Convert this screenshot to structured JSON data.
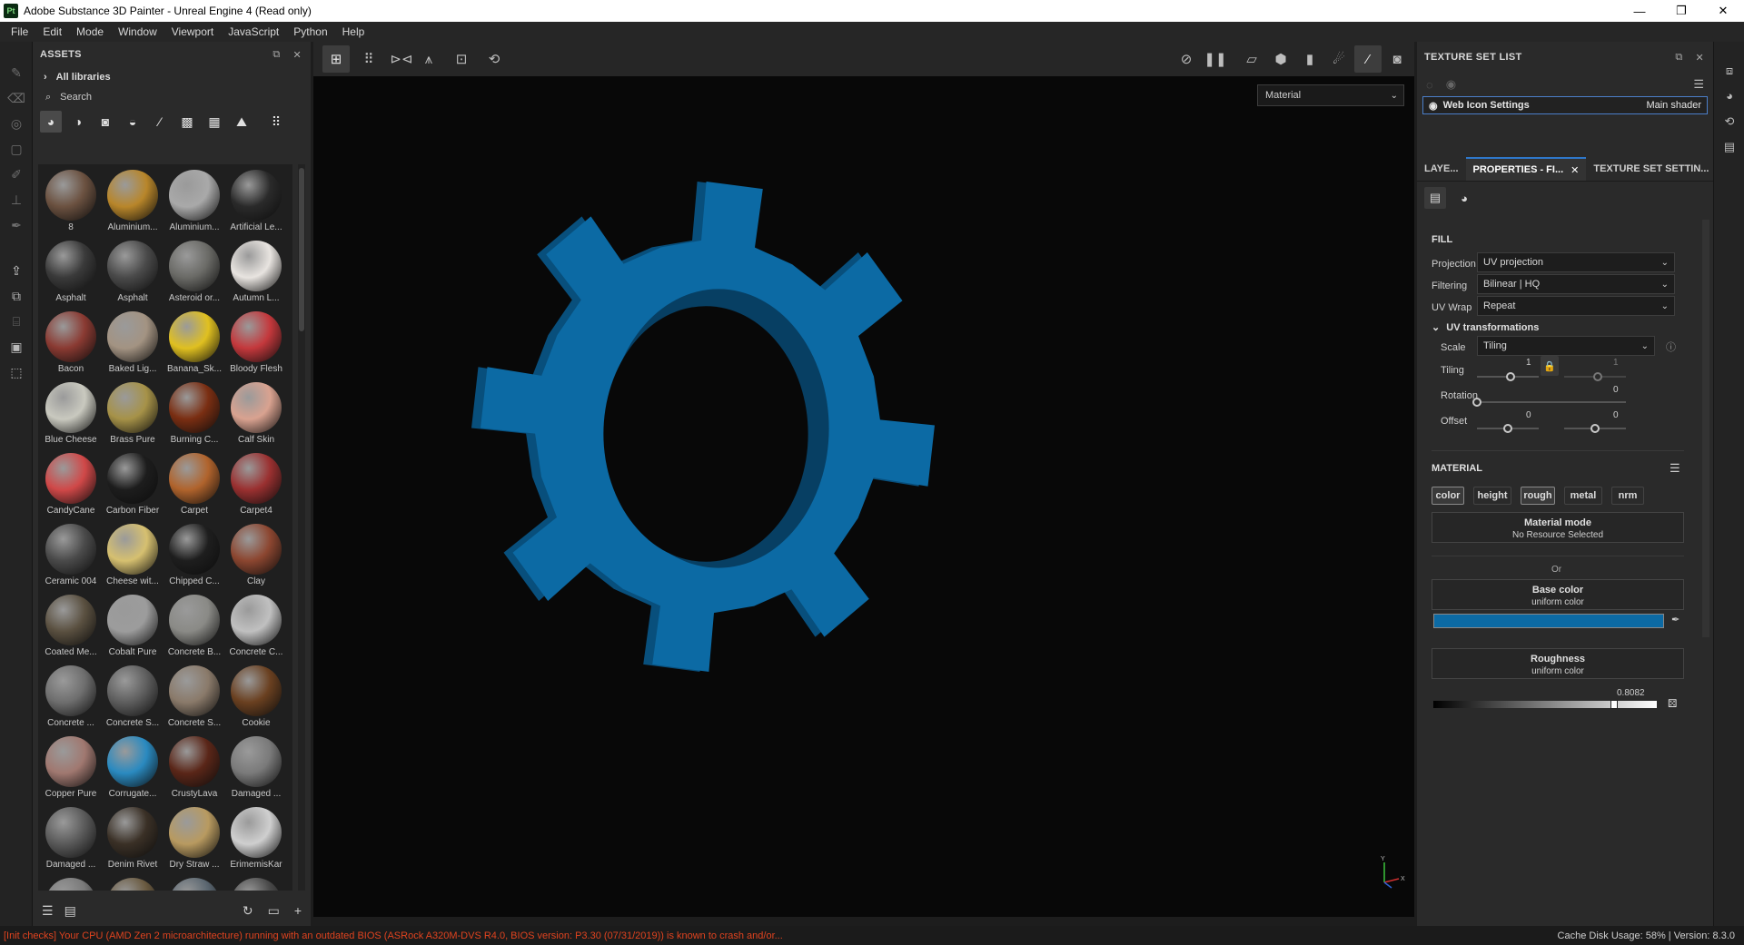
{
  "window": {
    "title": "Adobe Substance 3D Painter - Unreal Engine 4 (Read only)",
    "logo": "Pt"
  },
  "menu": [
    "File",
    "Edit",
    "Mode",
    "Window",
    "Viewport",
    "JavaScript",
    "Python",
    "Help"
  ],
  "assets": {
    "title": "ASSETS",
    "library": "All libraries",
    "search_placeholder": "Search",
    "items": [
      {
        "label": "8",
        "color": "#6b5140"
      },
      {
        "label": "Aluminium...",
        "color": "#b8862a"
      },
      {
        "label": "Aluminium...",
        "color": "#a9a9a9"
      },
      {
        "label": "Artificial Le...",
        "color": "#2a2a2a"
      },
      {
        "label": "Asphalt",
        "color": "#3a3a3a"
      },
      {
        "label": "Asphalt",
        "color": "#4a4a4a"
      },
      {
        "label": "Asteroid or...",
        "color": "#6a6a66"
      },
      {
        "label": "Autumn L...",
        "color": "#e8e4e0"
      },
      {
        "label": "Bacon",
        "color": "#8a3a32"
      },
      {
        "label": "Baked Lig...",
        "color": "#a39382"
      },
      {
        "label": "Banana_Sk...",
        "color": "#e0c020"
      },
      {
        "label": "Bloody Flesh",
        "color": "#c4383c"
      },
      {
        "label": "Blue Cheese",
        "color": "#c9c9bf"
      },
      {
        "label": "Brass Pure",
        "color": "#a69248"
      },
      {
        "label": "Burning C...",
        "color": "#7a2e12"
      },
      {
        "label": "Calf Skin",
        "color": "#d9a290"
      },
      {
        "label": "CandyCane",
        "color": "#d04848"
      },
      {
        "label": "Carbon Fiber",
        "color": "#1d1d1d"
      },
      {
        "label": "Carpet",
        "color": "#b0632c"
      },
      {
        "label": "Carpet4",
        "color": "#9a3030"
      },
      {
        "label": "Ceramic 004",
        "color": "#4a4a4a"
      },
      {
        "label": "Cheese wit...",
        "color": "#d6c070"
      },
      {
        "label": "Chipped C...",
        "color": "#1e1e1e"
      },
      {
        "label": "Clay",
        "color": "#8c4630"
      },
      {
        "label": "Coated Me...",
        "color": "#5a5040"
      },
      {
        "label": "Cobalt Pure",
        "color": "#9c9c9c"
      },
      {
        "label": "Concrete B...",
        "color": "#8a8a86"
      },
      {
        "label": "Concrete C...",
        "color": "#c0c0c0"
      },
      {
        "label": "Concrete ...",
        "color": "#6e6e6e"
      },
      {
        "label": "Concrete S...",
        "color": "#5e5e5e"
      },
      {
        "label": "Concrete S...",
        "color": "#8a7a6a"
      },
      {
        "label": "Cookie",
        "color": "#6a4020"
      },
      {
        "label": "Copper Pure",
        "color": "#a07870"
      },
      {
        "label": "Corrugate...",
        "color": "#2a8ac0"
      },
      {
        "label": "CrustyLava",
        "color": "#5a2618"
      },
      {
        "label": "Damaged ...",
        "color": "#7a7a7a"
      },
      {
        "label": "Damaged ...",
        "color": "#5a5a5a"
      },
      {
        "label": "Denim Rivet",
        "color": "#3a3026"
      },
      {
        "label": "Dry Straw ...",
        "color": "#b89a60"
      },
      {
        "label": "ErimemisKar",
        "color": "#cfcfcf"
      },
      {
        "label": "",
        "color": "#7a7a7a"
      },
      {
        "label": "",
        "color": "#6a5a40"
      },
      {
        "label": "",
        "color": "#5a6670"
      },
      {
        "label": "",
        "color": "#4a4a4a"
      }
    ]
  },
  "viewport": {
    "material_mode": "Material",
    "object_color": "#0c6aa4",
    "axis_y": "Y",
    "axis_x": "X"
  },
  "texture_set_list": {
    "title": "TEXTURE SET LIST",
    "item_name": "Web Icon Settings",
    "item_shader": "Main shader"
  },
  "tabs": [
    {
      "label": "LAYE...",
      "active": false
    },
    {
      "label": "PROPERTIES - FI...",
      "active": true
    },
    {
      "label": "TEXTURE SET SETTIN...",
      "active": false
    }
  ],
  "properties": {
    "fill_header": "FILL",
    "projection": {
      "label": "Projection",
      "value": "UV projection"
    },
    "filtering": {
      "label": "Filtering",
      "value": "Bilinear | HQ"
    },
    "uv_wrap": {
      "label": "UV Wrap",
      "value": "Repeat"
    },
    "uv_transform_header": "UV transformations",
    "scale": {
      "label": "Scale",
      "value": "Tiling"
    },
    "tiling": {
      "label": "Tiling",
      "value_a": "1",
      "value_b": "1",
      "fill_a": 0.55,
      "fill_b": 0.55
    },
    "rotation": {
      "label": "Rotation",
      "value": "0",
      "fill": 0.0
    },
    "offset": {
      "label": "Offset",
      "value_a": "0",
      "value_b": "0",
      "fill_a": 0.5,
      "fill_b": 0.5
    },
    "material_header": "MATERIAL",
    "channels": [
      {
        "label": "color",
        "on": true
      },
      {
        "label": "height",
        "on": false
      },
      {
        "label": "rough",
        "on": true
      },
      {
        "label": "metal",
        "on": false
      },
      {
        "label": "nrm",
        "on": false
      }
    ],
    "material_mode": {
      "title": "Material mode",
      "sub": "No Resource Selected"
    },
    "or": "Or",
    "base_color": {
      "title": "Base color",
      "sub": "uniform color",
      "swatch": "#0c6aa4"
    },
    "roughness": {
      "title": "Roughness",
      "sub": "uniform color",
      "value": "0.8082",
      "fill": 0.8082
    }
  },
  "status": {
    "error": "[Init checks] Your CPU (AMD Zen 2 microarchitecture) running with an outdated BIOS (ASRock A320M-DVS R4.0, BIOS version: P3.30 (07/31/2019)) is known to crash and/or...",
    "right": "Cache Disk Usage:   58% | Version: 8.3.0"
  }
}
